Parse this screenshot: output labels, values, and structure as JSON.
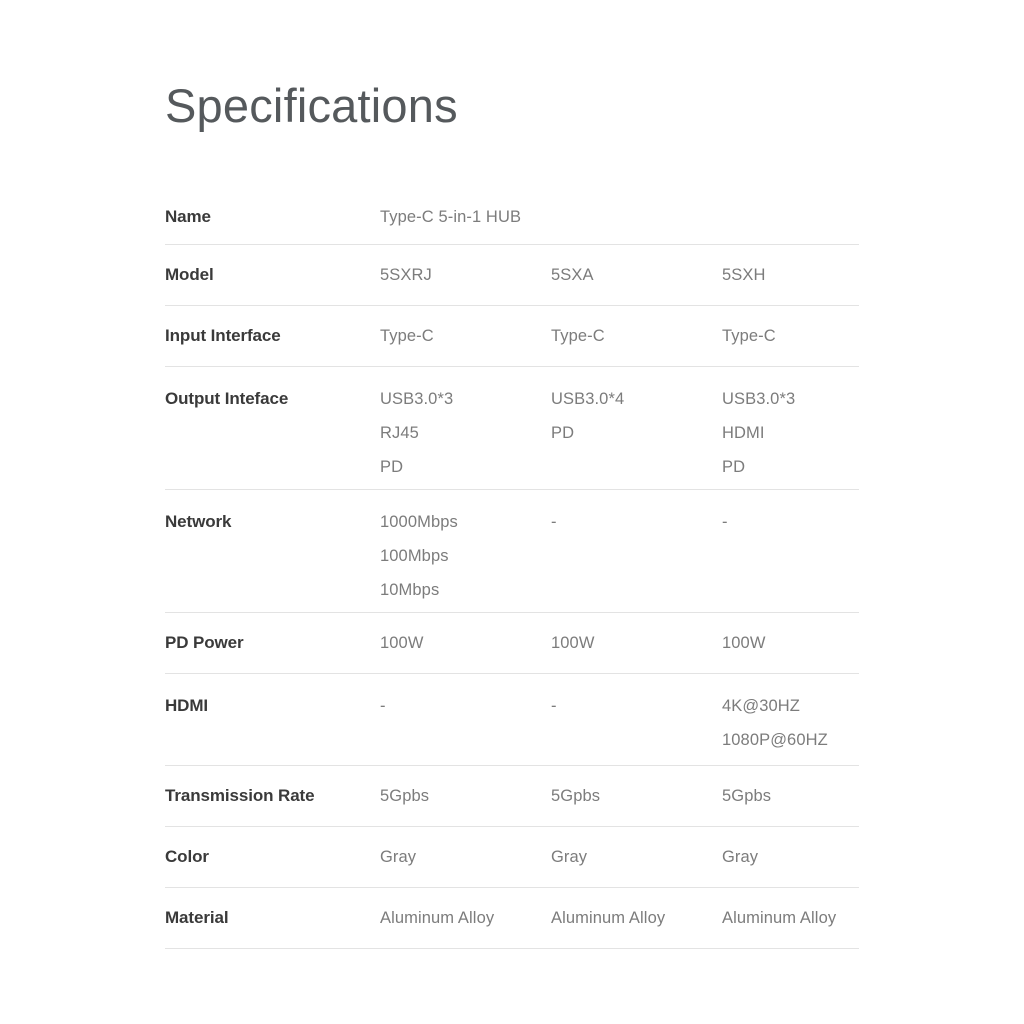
{
  "page": {
    "title": "Specifications",
    "background_color": "#ffffff",
    "label_color": "#3a3a3a",
    "value_color": "#7c7c7c",
    "divider_color": "#e3e3e3",
    "title_color": "#55595c"
  },
  "spec_table": {
    "rows": [
      {
        "label": "Name",
        "values": [
          [
            "Type-C 5-in-1 HUB"
          ],
          [],
          []
        ]
      },
      {
        "label": "Model",
        "values": [
          [
            "5SXRJ"
          ],
          [
            "5SXA"
          ],
          [
            "5SXH"
          ]
        ]
      },
      {
        "label": "Input Interface",
        "values": [
          [
            "Type-C"
          ],
          [
            "Type-C"
          ],
          [
            "Type-C"
          ]
        ]
      },
      {
        "label": "Output Inteface",
        "values": [
          [
            "USB3.0*3",
            "RJ45",
            "PD"
          ],
          [
            "USB3.0*4",
            "PD"
          ],
          [
            "USB3.0*3",
            "HDMI",
            "PD"
          ]
        ]
      },
      {
        "label": "Network",
        "values": [
          [
            "1000Mbps",
            "100Mbps",
            "10Mbps"
          ],
          [
            "-"
          ],
          [
            "-"
          ]
        ]
      },
      {
        "label": "PD Power",
        "values": [
          [
            "100W"
          ],
          [
            "100W"
          ],
          [
            "100W"
          ]
        ]
      },
      {
        "label": "HDMI",
        "values": [
          [
            "-"
          ],
          [
            "-"
          ],
          [
            "4K@30HZ",
            "1080P@60HZ"
          ]
        ]
      },
      {
        "label": "Transmission Rate",
        "values": [
          [
            "5Gpbs"
          ],
          [
            "5Gpbs"
          ],
          [
            "5Gpbs"
          ]
        ]
      },
      {
        "label": "Color",
        "values": [
          [
            "Gray"
          ],
          [
            "Gray"
          ],
          [
            "Gray"
          ]
        ]
      },
      {
        "label": "Material",
        "values": [
          [
            "Aluminum Alloy"
          ],
          [
            "Aluminum Alloy"
          ],
          [
            "Aluminum Alloy"
          ]
        ]
      }
    ]
  }
}
